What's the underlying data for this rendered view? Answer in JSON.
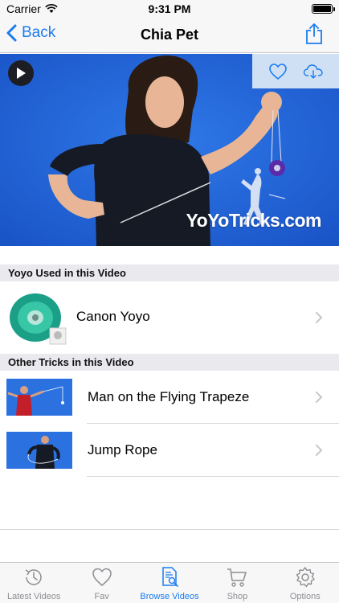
{
  "status": {
    "carrier": "Carrier",
    "time": "9:31 PM"
  },
  "nav": {
    "back_label": "Back",
    "title": "Chia Pet"
  },
  "video": {
    "watermark": "YoYoTricks.com"
  },
  "sections": {
    "yoyo_header": "Yoyo Used in this Video",
    "tricks_header": "Other Tricks in this Video"
  },
  "yoyo": {
    "name": "Canon Yoyo"
  },
  "tricks": [
    {
      "name": "Man on the Flying Trapeze"
    },
    {
      "name": "Jump Rope"
    }
  ],
  "tabs": [
    {
      "label": "Latest Videos",
      "icon": "history-icon"
    },
    {
      "label": "Fav",
      "icon": "heart-icon"
    },
    {
      "label": "Browse Videos",
      "icon": "document-search-icon"
    },
    {
      "label": "Shop",
      "icon": "cart-icon"
    },
    {
      "label": "Options",
      "icon": "gear-icon"
    }
  ],
  "colors": {
    "accent": "#1a7cf0",
    "video_bg": "#1f62d6",
    "section_bg": "#e9e9ee"
  }
}
